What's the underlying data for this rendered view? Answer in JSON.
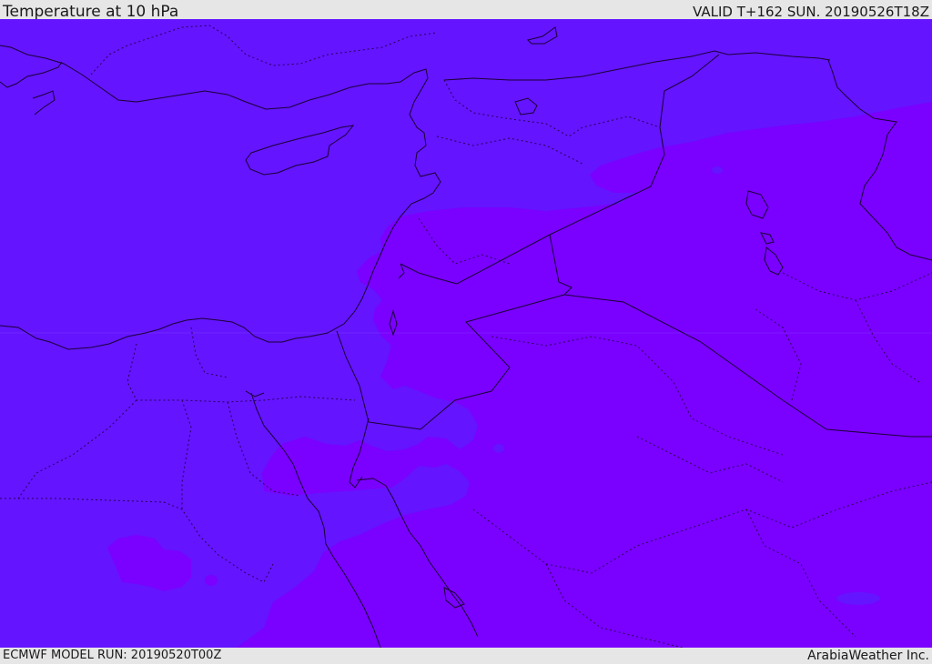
{
  "header": {
    "title": "Temperature at 10 hPa",
    "valid_time": "VALID T+162 SUN. 20190526T18Z"
  },
  "footer": {
    "model_run": "ECMWF MODEL RUN: 20190520T00Z",
    "credit": "ArabiaWeather Inc."
  },
  "map": {
    "colors": {
      "field_cool": "#6414ff",
      "field_warm": "#7a00ff",
      "coastline": "#1a0033",
      "border": "#1a0033"
    }
  }
}
